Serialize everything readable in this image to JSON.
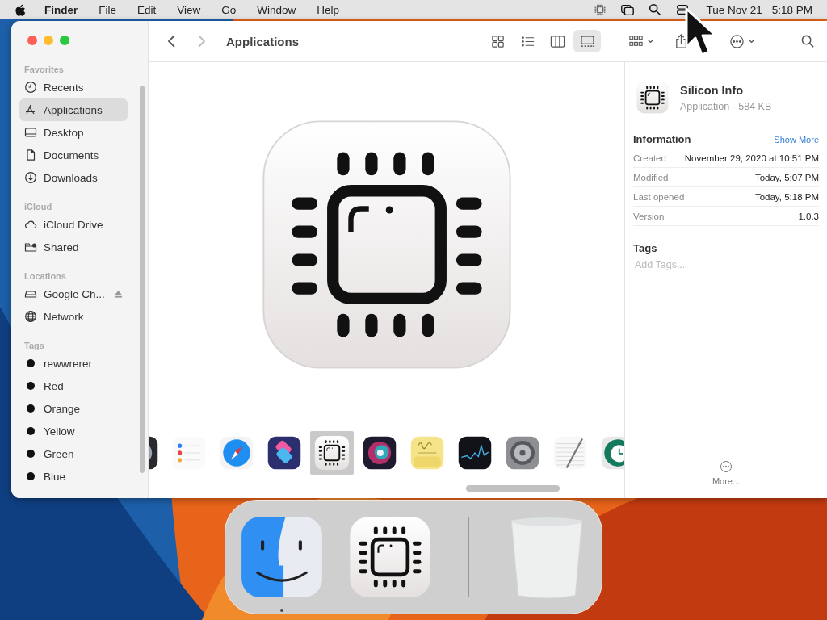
{
  "menu_bar": {
    "app_name": "Finder",
    "menus": [
      "File",
      "Edit",
      "View",
      "Go",
      "Window",
      "Help"
    ],
    "date": "Tue Nov 21",
    "time": "5:18 PM"
  },
  "window": {
    "title": "Applications",
    "back_disabled": false,
    "forward_disabled": true,
    "views": [
      {
        "kind": "grid",
        "selected": false
      },
      {
        "kind": "list",
        "selected": false
      },
      {
        "kind": "columns",
        "selected": false
      },
      {
        "kind": "gallery",
        "selected": true
      }
    ]
  },
  "sidebar": {
    "sections": [
      {
        "header": "Favorites",
        "items": [
          {
            "kind": "clock",
            "label": "Recents",
            "selected": false
          },
          {
            "kind": "apps",
            "label": "Applications",
            "selected": true
          },
          {
            "kind": "desktop",
            "label": "Desktop",
            "selected": false
          },
          {
            "kind": "document",
            "label": "Documents",
            "selected": false
          },
          {
            "kind": "download",
            "label": "Downloads",
            "selected": false
          }
        ]
      },
      {
        "header": "iCloud",
        "items": [
          {
            "kind": "cloud",
            "label": "iCloud Drive",
            "selected": false
          },
          {
            "kind": "shared",
            "label": "Shared",
            "selected": false
          }
        ]
      },
      {
        "header": "Locations",
        "items": [
          {
            "kind": "drive",
            "label": "Google Ch...",
            "selected": false,
            "eject": true
          },
          {
            "kind": "globe",
            "label": "Network",
            "selected": false,
            "eject": false
          }
        ]
      },
      {
        "header": "Tags",
        "items": [
          {
            "kind": "tag",
            "label": "rewwrerer",
            "selected": false
          },
          {
            "kind": "tag",
            "label": "Red",
            "selected": false
          },
          {
            "kind": "tag",
            "label": "Orange",
            "selected": false
          },
          {
            "kind": "tag",
            "label": "Yellow",
            "selected": false
          },
          {
            "kind": "tag",
            "label": "Green",
            "selected": false
          },
          {
            "kind": "tag",
            "label": "Blue",
            "selected": false
          }
        ]
      }
    ]
  },
  "gallery": [
    {
      "kind": "quicktime",
      "selected": false
    },
    {
      "kind": "reminders",
      "selected": false
    },
    {
      "kind": "safari",
      "selected": false
    },
    {
      "kind": "shortcuts",
      "selected": false
    },
    {
      "kind": "chip",
      "selected": true
    },
    {
      "kind": "siri",
      "selected": false
    },
    {
      "kind": "stickies",
      "selected": false
    },
    {
      "kind": "stocks",
      "selected": false
    },
    {
      "kind": "settings",
      "selected": false
    },
    {
      "kind": "textedit",
      "selected": false
    },
    {
      "kind": "timemachine",
      "selected": false
    }
  ],
  "info": {
    "name": "Silicon Info",
    "subtitle": "Application - 584 KB",
    "section_title": "Information",
    "show_more": "Show More",
    "rows": [
      {
        "label": "Created",
        "value": "November 29, 2020 at 10:51 PM"
      },
      {
        "label": "Modified",
        "value": "Today, 5:07 PM"
      },
      {
        "label": "Last opened",
        "value": "Today, 5:18 PM"
      },
      {
        "label": "Version",
        "value": "1.0.3"
      }
    ],
    "tags_title": "Tags",
    "tags_placeholder": "Add Tags...",
    "more": "More..."
  },
  "dock": [
    {
      "kind": "finder",
      "running": true
    },
    {
      "kind": "chip",
      "running": false
    },
    {
      "kind": "separator"
    },
    {
      "kind": "trash",
      "running": false
    }
  ]
}
